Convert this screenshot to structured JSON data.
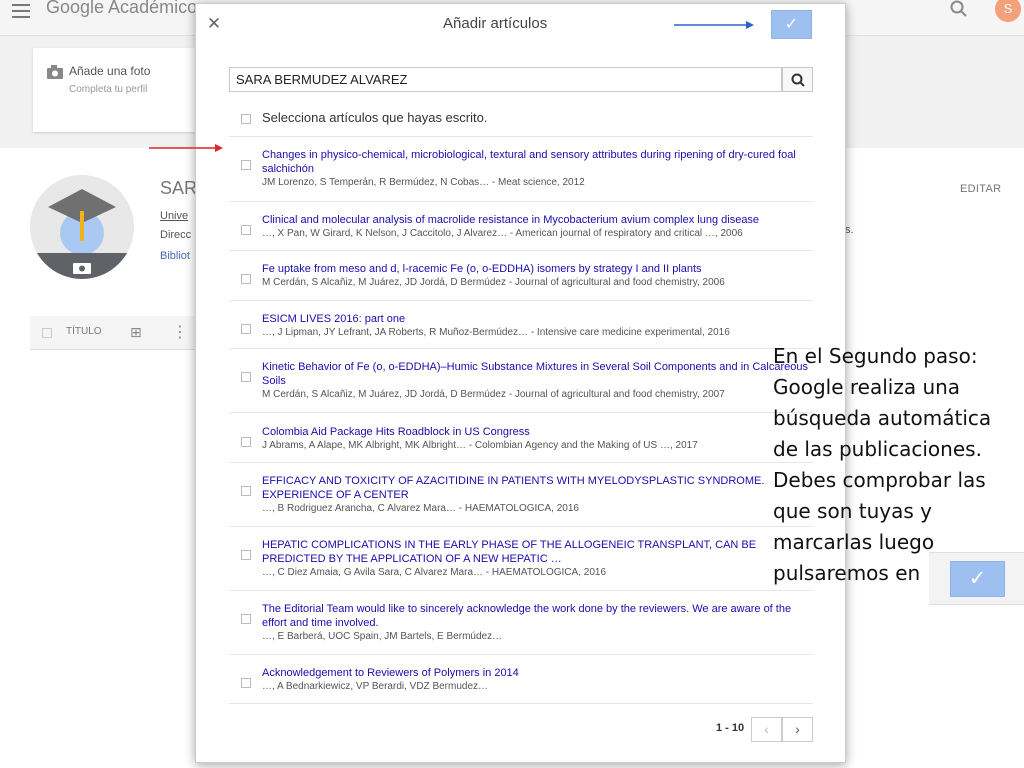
{
  "app": {
    "logo": "Google Académico",
    "avatar_initial": "S",
    "add_photo": "Añade una foto",
    "complete_profile": "Completa tu perfil",
    "name_fragment": "SAR",
    "univ_fragment": "Unive",
    "dir_fragment": "Direcc",
    "bib_fragment": "Bibliot",
    "edit": "EDITAR",
    "stray_text": "s.",
    "table_title_header": "TÍTULO"
  },
  "dialog": {
    "title": "Añadir artículos",
    "search_value": "SARA BERMUDEZ ALVAREZ",
    "select_label": "Selecciona artículos que hayas escrito.",
    "confirm_icon": "check-icon",
    "articles": [
      {
        "title": "Changes in physico-chemical, microbiological, textural and sensory attributes during ripening of dry-cured foal salchichón",
        "meta": "JM Lorenzo, S Temperán, R Bermúdez, N Cobas… - Meat science, 2012"
      },
      {
        "title": "Clinical and molecular analysis of macrolide resistance in Mycobacterium avium complex lung disease",
        "meta": "…, X Pan, W Girard, K Nelson, J Caccitolo, J Alvarez… - American journal of respiratory and critical …, 2006"
      },
      {
        "title": "Fe uptake from meso and d, l-racemic Fe (o, o-EDDHA) isomers by strategy I and II plants",
        "meta": "M Cerdán, S Alcañiz, M Juárez, JD Jordá, D Bermúdez - Journal of agricultural and food chemistry, 2006"
      },
      {
        "title": "ESICM LIVES 2016: part one",
        "meta": "…, J Lipman, JY Lefrant, JA Roberts, R Muñoz-Bermúdez… - Intensive care medicine experimental, 2016"
      },
      {
        "title": "Kinetic Behavior of Fe (o, o-EDDHA)–Humic Substance Mixtures in Several Soil Components and in Calcareous Soils",
        "meta": "M Cerdán, S Alcañiz, M Juárez, JD Jordá, D Bermúdez - Journal of agricultural and food chemistry, 2007"
      },
      {
        "title": "Colombia Aid Package Hits Roadblock in US Congress",
        "meta": "J Abrams, A Alape, MK Albright, MK Albright… - Colombian Agency and the Making of US …, 2017"
      },
      {
        "title": "EFFICACY AND TOXICITY OF AZACITIDINE IN PATIENTS WITH MYELODYSPLASTIC SYNDROME. EXPERIENCE OF A CENTER",
        "meta": "…, B Rodriguez Arancha, C Alvarez Mara… - HAEMATOLOGICA, 2016"
      },
      {
        "title": "HEPATIC COMPLICATIONS IN THE EARLY PHASE OF THE ALLOGENEIC TRANSPLANT, CAN BE PREDICTED BY THE APPLICATION OF A NEW HEPATIC …",
        "meta": "…, C Diez Amaia, G Avila Sara, C Alvarez Mara… - HAEMATOLOGICA, 2016"
      },
      {
        "title": "The Editorial Team would like to sincerely acknowledge the work done by the reviewers. We are aware of the effort and time involved.",
        "meta": "…, E Barberá, UOC Spain, JM Bartels, E Bermúdez…"
      },
      {
        "title": "Acknowledgement to Reviewers of Polymers in 2014",
        "meta": "…, A Bednarkiewicz, VP Berardi, VDZ Bermudez…"
      }
    ],
    "pagination": "1 - 10"
  },
  "annotation": {
    "text": "En el Segundo paso: Google realiza una búsqueda automática de las publicaciones. Debes comprobar las que son tuyas y marcarlas luego pulsaremos en"
  },
  "colors": {
    "accent_button": "#9dc0f0",
    "link": "#1a0dab",
    "arrow_top": "#2b62c9",
    "arrow_left": "#d9262a"
  }
}
